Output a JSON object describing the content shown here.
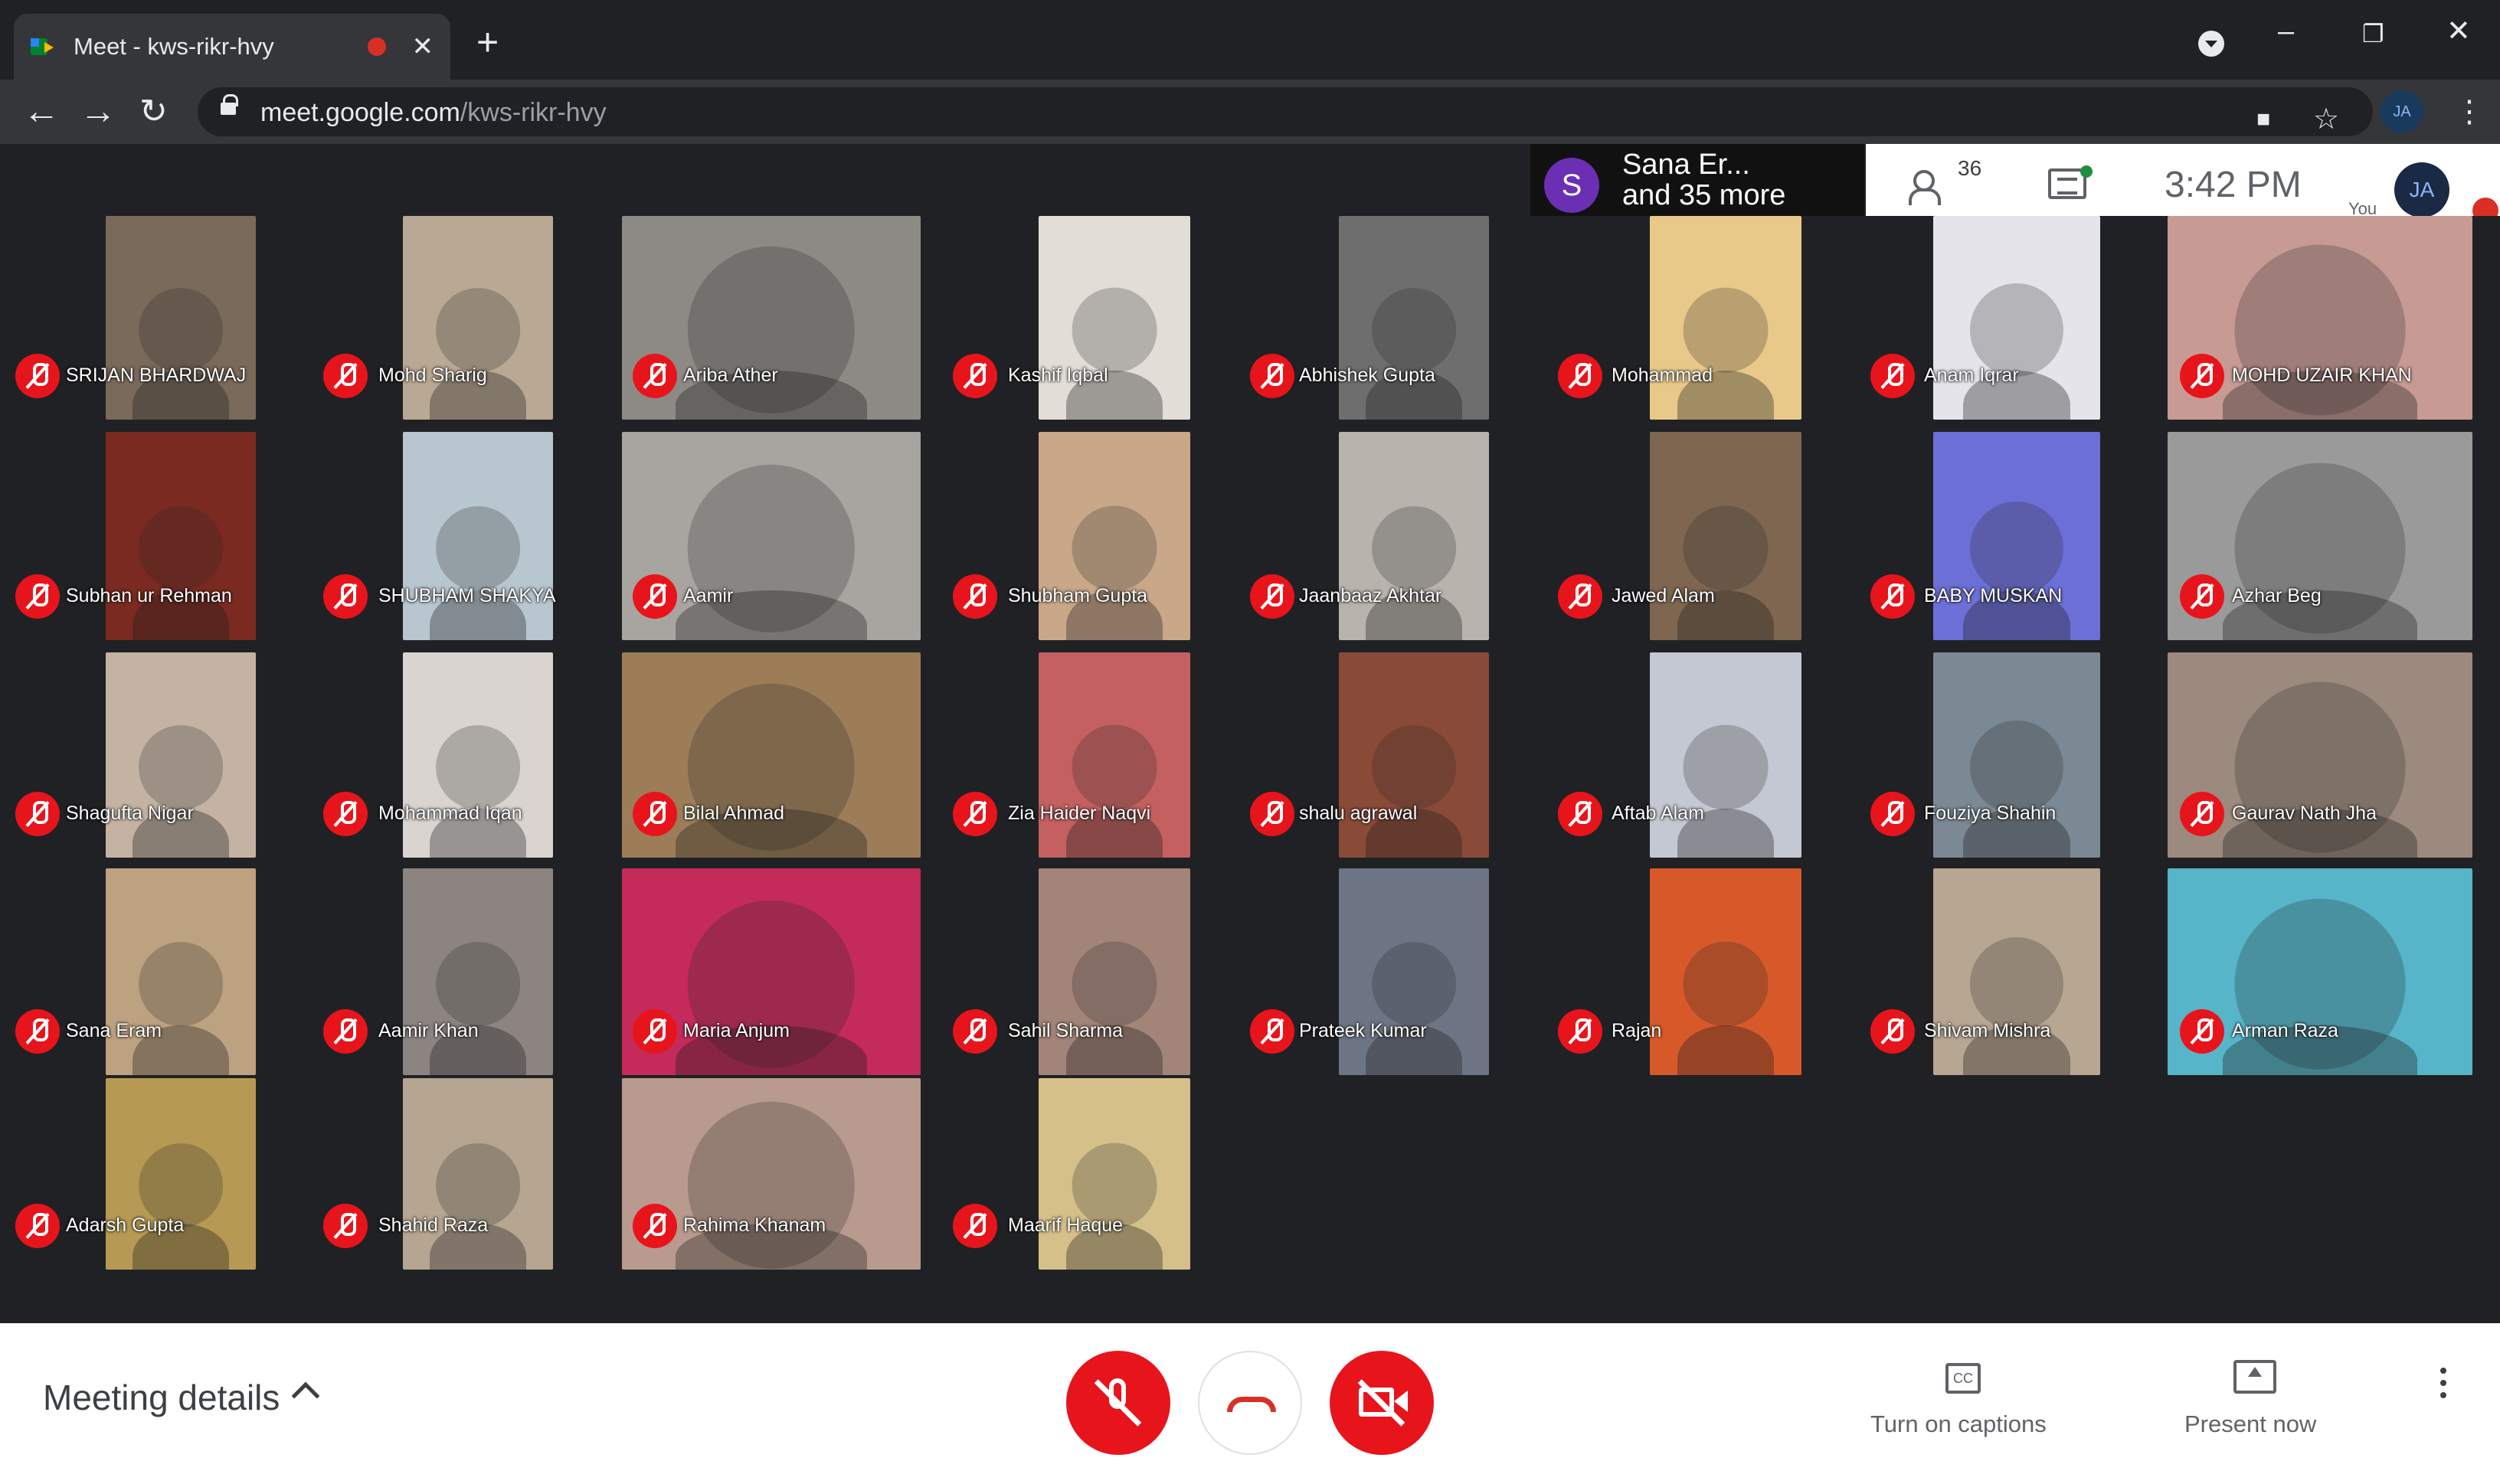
{
  "browser": {
    "tab_title": "Meet - kws-rikr-hvy",
    "url_host": "meet.google.com",
    "url_path": "/kws-rikr-hvy",
    "profile_initials": "JA"
  },
  "meet": {
    "presenter_initial": "S",
    "presenter_line1": "Sana Er...",
    "presenter_line2": "and 35 more",
    "participant_count": "36",
    "time": "3:42 PM",
    "you_label": "You",
    "self_initials": "JA"
  },
  "participants": [
    {
      "name": "SRIJAN BHARDWAJ",
      "color": "#7a6a5a"
    },
    {
      "name": "Mohd Sharig",
      "color": "#b9a893"
    },
    {
      "name": "Ariba Ather",
      "color": "#8d8a86"
    },
    {
      "name": "Kashif Iqbal",
      "color": "#e2ddd6"
    },
    {
      "name": "Abhishek Gupta",
      "color": "#6e6e6e"
    },
    {
      "name": "Mohammad",
      "color": "#e9c98a"
    },
    {
      "name": "Anam Iqrar",
      "color": "#e4e4ea"
    },
    {
      "name": "MOHD UZAIR KHAN",
      "color": "#c79a93"
    },
    {
      "name": "Subhan ur Rehman",
      "color": "#7a2a20"
    },
    {
      "name": "SHUBHAM SHAKYA",
      "color": "#b8c6cf"
    },
    {
      "name": "Aamir",
      "color": "#a8a4a0"
    },
    {
      "name": "Shubham Gupta",
      "color": "#c9a88a"
    },
    {
      "name": "Jaanbaaz Akhtar",
      "color": "#b9b3ad"
    },
    {
      "name": "Jawed Alam",
      "color": "#7e6650"
    },
    {
      "name": "BABY MUSKAN",
      "color": "#6c6fd6"
    },
    {
      "name": "Azhar Beg",
      "color": "#9a9a9a"
    },
    {
      "name": "Shagufta Nigar",
      "color": "#c4b3a3"
    },
    {
      "name": "Mohammad Iqan",
      "color": "#d9d4cf"
    },
    {
      "name": "Bilal Ahmad",
      "color": "#9d7d58"
    },
    {
      "name": "Zia Haider Naqvi",
      "color": "#c46060"
    },
    {
      "name": "shalu agrawal",
      "color": "#8a4a38"
    },
    {
      "name": "Aftab Alam",
      "color": "#c4c8d2"
    },
    {
      "name": "Fouziya Shahin",
      "color": "#7b8995"
    },
    {
      "name": "Gaurav Nath Jha",
      "color": "#9b8a7d"
    },
    {
      "name": "Sana Eram",
      "color": "#bda281"
    },
    {
      "name": "Aamir Khan",
      "color": "#8c8480"
    },
    {
      "name": "Maria Anjum",
      "color": "#c42a5a"
    },
    {
      "name": "Sahil Sharma",
      "color": "#a38478"
    },
    {
      "name": "Prateek Kumar",
      "color": "#6d7585"
    },
    {
      "name": "Rajan",
      "color": "#d7592a"
    },
    {
      "name": "Shivam Mishra",
      "color": "#b7a691"
    },
    {
      "name": "Arman Raza",
      "color": "#56b5c8"
    },
    {
      "name": "Adarsh Gupta",
      "color": "#b69a54"
    },
    {
      "name": "Shahid Raza",
      "color": "#b5a591"
    },
    {
      "name": "Rahima Khanam",
      "color": "#b89b8e"
    },
    {
      "name": "Maarif Haque",
      "color": "#d6c08a"
    }
  ],
  "controls": {
    "meeting_details": "Meeting details",
    "captions_label": "Turn on captions",
    "present_label": "Present now"
  },
  "colors": {
    "mute_red": "#e8141c",
    "background": "#202124"
  }
}
